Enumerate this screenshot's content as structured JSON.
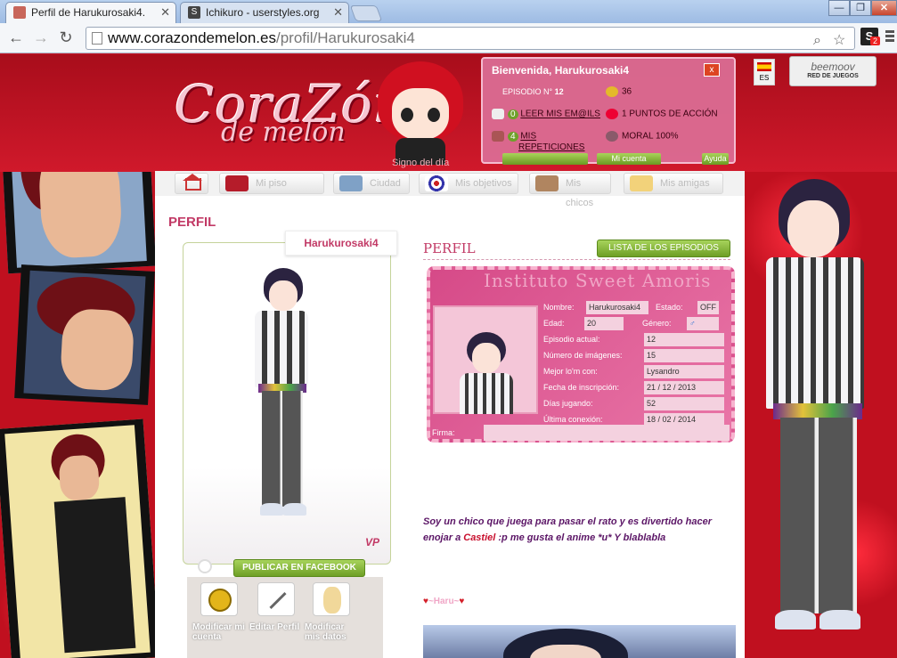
{
  "browser": {
    "tabs": [
      {
        "title": "Perfil de Harukurosaki4.",
        "favicon": "cake-icon",
        "active": true
      },
      {
        "title": "Ichikuro - userstyles.org",
        "favicon": "s-icon",
        "active": false
      }
    ],
    "url_domain": "www.corazondemelon.es",
    "url_path": "/profil/Harukurosaki4",
    "extension_badge": "2",
    "window_buttons": {
      "minimize": "—",
      "maximize": "❐",
      "close": "✕"
    }
  },
  "header": {
    "logo_main": "CoraZón",
    "logo_sub": "de melón",
    "sign_of_day": "Signo del día",
    "welcome": {
      "title": "Bienvenida, Harukurosaki4",
      "close": "x",
      "episode_label": "EPISODIO N°",
      "episode_number": "12",
      "coins": "36",
      "mail_count": "0",
      "mail_label": "LEER MIS EM@ILS",
      "action_points": "1 PUNTOS DE ACCIÓN",
      "replays_count": "4",
      "replays_label_1": "MIS",
      "replays_label_2": "REPETICIONES",
      "moral": "MORAL 100%",
      "account_button": "Mi cuenta",
      "help_button": "Ayuda"
    },
    "language": "ES",
    "network_logo": "beemoov",
    "network_label": "RED DE JUEGOS"
  },
  "nav": {
    "items": [
      "Mi piso",
      "Ciudad",
      "Mis objetivos",
      "Mis chicos",
      "Mis amigas"
    ]
  },
  "profile": {
    "section_title": "PERFIL",
    "username_tab": "Harukurosaki4",
    "vp": "VP",
    "facebook_button": "PUBLICAR EN FACEBOOK",
    "actions": [
      {
        "label": "Modificar mi cuenta"
      },
      {
        "label": "Editar Perfil"
      },
      {
        "label": "Modificar mis datos"
      }
    ]
  },
  "right": {
    "title": "PERFIL",
    "episodes_button": "LISTA DE LOS EPISODIOS",
    "card": {
      "school": "Instituto Sweet Amoris",
      "fields": [
        {
          "label": "Nombre:",
          "value": "Harukurosaki4"
        },
        {
          "label": "Estado:",
          "value": "OFF"
        },
        {
          "label": "Edad:",
          "value": "20"
        },
        {
          "label": "Género:",
          "value": "♂"
        },
        {
          "label": "Episodio actual:",
          "value": "12"
        },
        {
          "label": "Número de imágenes:",
          "value": "15"
        },
        {
          "label": "Mejor lo'm con:",
          "value": "Lysandro"
        },
        {
          "label": "Fecha de inscripción:",
          "value": "21 / 12 / 2013"
        },
        {
          "label": "Días jugando:",
          "value": "52"
        },
        {
          "label": "Última conexión:",
          "value": "18 / 02 / 2014"
        }
      ],
      "firma_label": "Firma:"
    },
    "bio_1": "Soy un chico que juega para pasar el rato y es divertido hacer enojar a ",
    "bio_castiel": "Castiel",
    "bio_2": " :p me gusta el anime *u* Y blablabla",
    "signature": "~Haru~",
    "heart": "♥"
  },
  "colors": {
    "accent_pink": "#c23a66",
    "button_green": "#6e9f25",
    "background_red": "#c0101f"
  }
}
